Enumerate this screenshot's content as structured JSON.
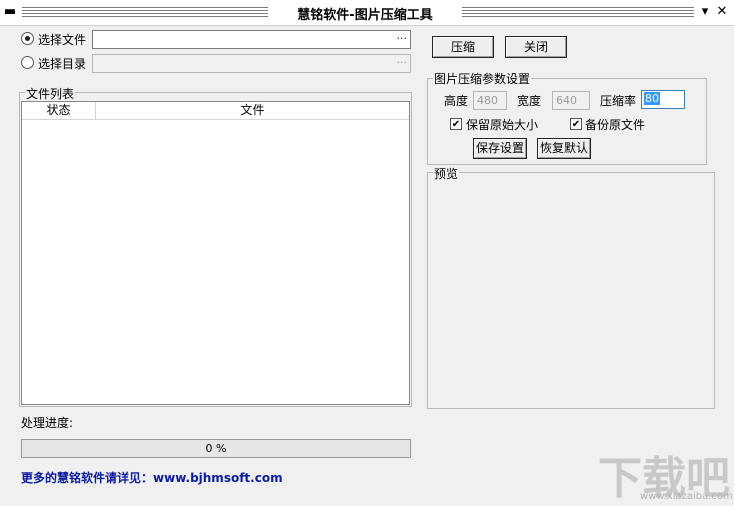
{
  "window": {
    "title": "慧铭软件-图片压缩工具",
    "min_glyph": "▬",
    "minimize_glyph": "▾",
    "close_glyph": "✕"
  },
  "source": {
    "file_label": "选择文件",
    "dir_label": "选择目录",
    "file_value": "",
    "dir_value": "",
    "browse_glyph": "···",
    "selected": "file"
  },
  "file_list": {
    "title": "文件列表",
    "columns": [
      "状态",
      "文件"
    ]
  },
  "progress": {
    "label": "处理进度:",
    "value": 0,
    "text": "0 %"
  },
  "footer": {
    "prefix": "更多的慧铭软件请详见：",
    "link": "www.bjhmsoft.com"
  },
  "actions": {
    "compress": "压缩",
    "close": "关闭"
  },
  "settings": {
    "title": "图片压缩参数设置",
    "height_label": "高度",
    "height_value": "480",
    "width_label": "宽度",
    "width_value": "640",
    "rate_label": "压缩率",
    "rate_value": "80",
    "keep_size_label": "保留原始大小",
    "keep_size_checked": true,
    "backup_label": "备份原文件",
    "backup_checked": true,
    "save_label": "保存设置",
    "reset_label": "恢复默认"
  },
  "preview": {
    "title": "预览"
  },
  "watermark": {
    "text": "下载吧",
    "url": "www.xiazaiba.com"
  }
}
